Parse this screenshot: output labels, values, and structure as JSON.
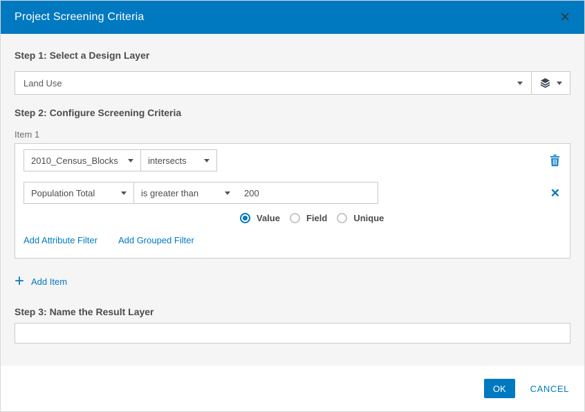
{
  "colors": {
    "header_bg": "#0079c1",
    "accent_blue": "#0079c1",
    "body_bg": "#f5f5f5",
    "panel_bg": "#ffffff",
    "border": "#c9c9c9",
    "text_dark": "#4c4c4c",
    "text_muted": "#6e6e6e"
  },
  "header": {
    "title": "Project Screening Criteria",
    "close_icon": "✕"
  },
  "step1": {
    "label": "Step 1: Select a Design Layer",
    "layer_select": {
      "value": "Land Use"
    },
    "layers_button_icon": "layers-icon"
  },
  "step2": {
    "label": "Step 2: Configure Screening Criteria",
    "item": {
      "title": "Item 1",
      "layer_select": {
        "value": "2010_Census_Blocks"
      },
      "operator_select": {
        "value": "intersects"
      },
      "delete_icon": "trash-icon",
      "attribute_filter": {
        "field_select": {
          "value": "Population Total"
        },
        "operator_select": {
          "value": "is greater than"
        },
        "value_input": {
          "value": "200"
        },
        "remove_icon": "✕",
        "radio_options": [
          {
            "label": "Value",
            "selected": true
          },
          {
            "label": "Field",
            "selected": false
          },
          {
            "label": "Unique",
            "selected": false
          }
        ]
      },
      "links": {
        "add_attribute_filter": "Add Attribute Filter",
        "add_grouped_filter": "Add Grouped Filter"
      }
    },
    "add_item_icon": "+",
    "add_item_label": "Add Item"
  },
  "step3": {
    "label": "Step 3: Name the Result Layer",
    "name_input": {
      "value": "",
      "placeholder": ""
    }
  },
  "footer": {
    "ok_label": "OK",
    "cancel_label": "CANCEL"
  }
}
